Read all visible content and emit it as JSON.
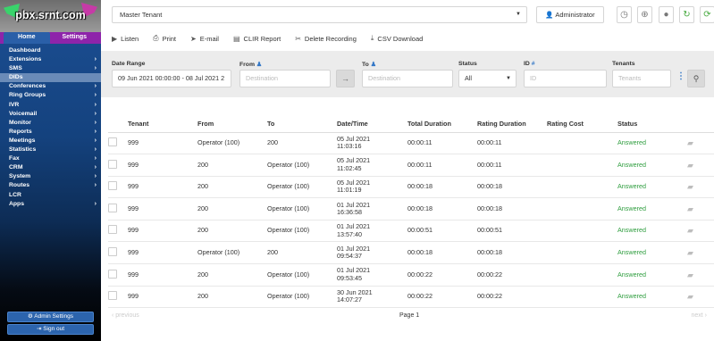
{
  "brand": {
    "logo_text": "pbx.srnt.com"
  },
  "sidebar": {
    "tabs": [
      {
        "label": "Home"
      },
      {
        "label": "Settings"
      }
    ],
    "items": [
      {
        "label": "Dashboard",
        "arrow": ""
      },
      {
        "label": "Extensions",
        "arrow": "›"
      },
      {
        "label": "SMS",
        "arrow": "›"
      },
      {
        "label": "DIDs",
        "arrow": ""
      },
      {
        "label": "Conferences",
        "arrow": "›"
      },
      {
        "label": "Ring Groups",
        "arrow": "›"
      },
      {
        "label": "IVR",
        "arrow": "›"
      },
      {
        "label": "Voicemail",
        "arrow": "›"
      },
      {
        "label": "Monitor",
        "arrow": "›"
      },
      {
        "label": "Reports",
        "arrow": "›"
      },
      {
        "label": "Meetings",
        "arrow": "›"
      },
      {
        "label": "Statistics",
        "arrow": "›"
      },
      {
        "label": "Fax",
        "arrow": "›"
      },
      {
        "label": "CRM",
        "arrow": "›"
      },
      {
        "label": "System",
        "arrow": "›"
      },
      {
        "label": "Routes",
        "arrow": "›"
      },
      {
        "label": "LCR",
        "arrow": ""
      },
      {
        "label": "Apps",
        "arrow": "›"
      }
    ],
    "admin_settings": "Admin Settings",
    "sign_out": "Sign out"
  },
  "topbar": {
    "tenant": "Master Tenant",
    "user": "Administrator"
  },
  "toolbar": {
    "listen": "Listen",
    "print": "Print",
    "email": "E-mail",
    "cdr_report": "CLIR Report",
    "delete_recording": "Delete Recording",
    "csv_download": "CSV Download"
  },
  "filters": {
    "date_range_label": "Date Range",
    "date_range_value": "09 Jun 2021 00:00:00 - 08 Jul 2021 2",
    "from_label": "From",
    "from_placeholder": "Destination",
    "to_label": "To",
    "to_placeholder": "Destination",
    "status_label": "Status",
    "status_value": "All",
    "id_label": "ID",
    "id_placeholder": "ID",
    "tenants_label": "Tenants",
    "tenants_placeholder": "Tenants"
  },
  "table": {
    "headers": [
      "Tenant",
      "From",
      "To",
      "Date/Time",
      "Total Duration",
      "Rating Duration",
      "Rating Cost",
      "Status"
    ],
    "rows": [
      {
        "tenant": "999",
        "from": "Operator (100)",
        "to": "200",
        "date": "05 Jul 2021",
        "time": "11:03:16",
        "total": "00:00:11",
        "rating": "00:00:11",
        "cost": "",
        "status": "Answered"
      },
      {
        "tenant": "999",
        "from": "200",
        "to": "Operator (100)",
        "date": "05 Jul 2021",
        "time": "11:02:45",
        "total": "00:00:11",
        "rating": "00:00:11",
        "cost": "",
        "status": "Answered"
      },
      {
        "tenant": "999",
        "from": "200",
        "to": "Operator (100)",
        "date": "05 Jul 2021",
        "time": "11:01:19",
        "total": "00:00:18",
        "rating": "00:00:18",
        "cost": "",
        "status": "Answered"
      },
      {
        "tenant": "999",
        "from": "200",
        "to": "Operator (100)",
        "date": "01 Jul 2021",
        "time": "16:36:58",
        "total": "00:00:18",
        "rating": "00:00:18",
        "cost": "",
        "status": "Answered"
      },
      {
        "tenant": "999",
        "from": "200",
        "to": "Operator (100)",
        "date": "01 Jul 2021",
        "time": "13:57:40",
        "total": "00:00:51",
        "rating": "00:00:51",
        "cost": "",
        "status": "Answered"
      },
      {
        "tenant": "999",
        "from": "Operator (100)",
        "to": "200",
        "date": "01 Jul 2021",
        "time": "09:54:37",
        "total": "00:00:18",
        "rating": "00:00:18",
        "cost": "",
        "status": "Answered"
      },
      {
        "tenant": "999",
        "from": "200",
        "to": "Operator (100)",
        "date": "01 Jul 2021",
        "time": "09:53:45",
        "total": "00:00:22",
        "rating": "00:00:22",
        "cost": "",
        "status": "Answered"
      },
      {
        "tenant": "999",
        "from": "200",
        "to": "Operator (100)",
        "date": "30 Jun 2021",
        "time": "14:07:27",
        "total": "00:00:22",
        "rating": "00:00:22",
        "cost": "",
        "status": "Answered"
      }
    ]
  },
  "pager": {
    "prev": "‹ previous",
    "page": "Page 1",
    "next": "next ›"
  },
  "colors": {
    "sidebar": "#14427e",
    "brand": "#8e24aa",
    "answered": "#2e9d3e",
    "accent": "#3478c7"
  }
}
